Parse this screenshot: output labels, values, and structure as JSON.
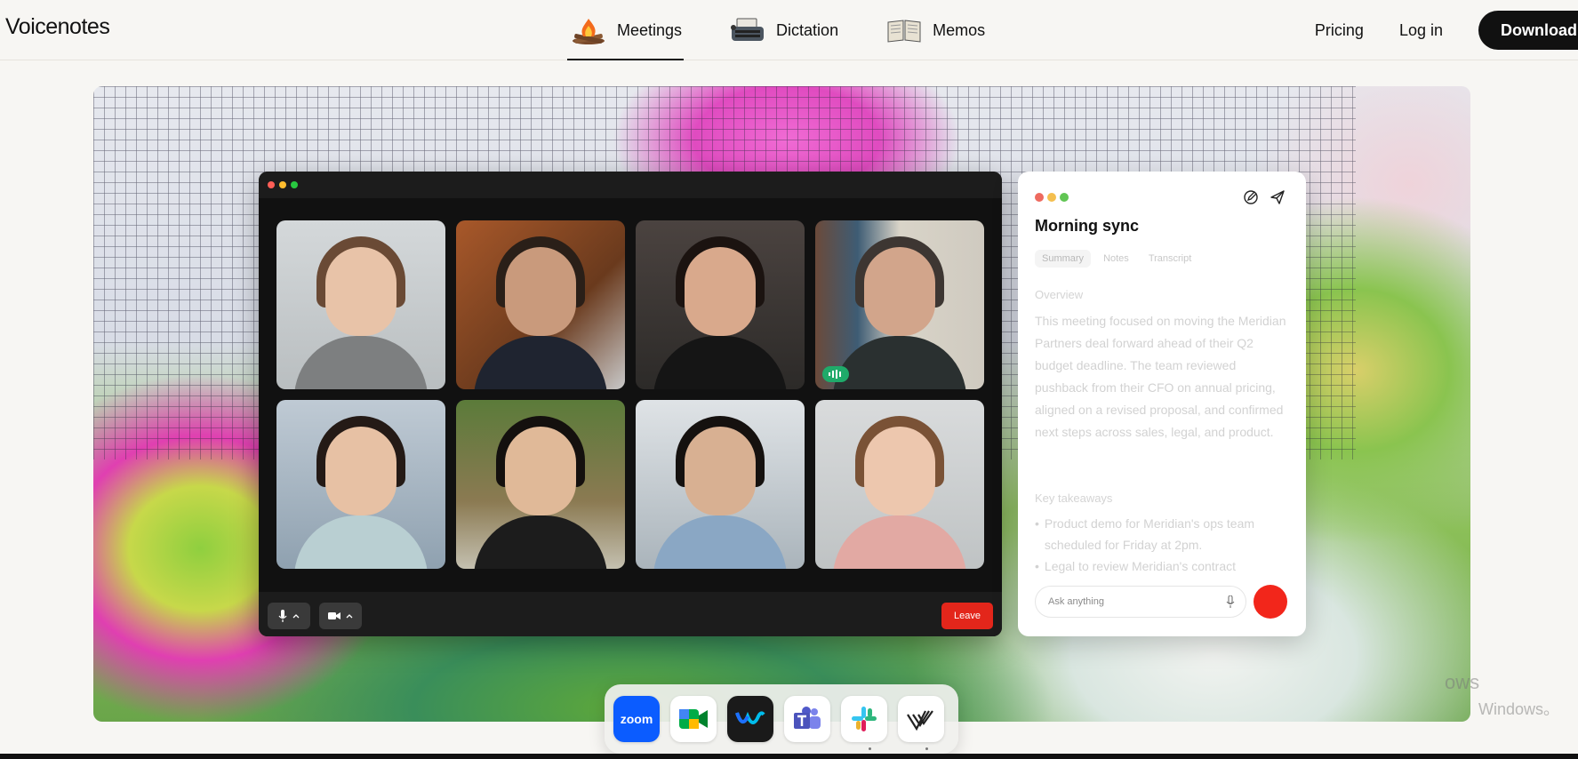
{
  "header": {
    "brand": "Voicenotes",
    "nav": [
      {
        "label": "Meetings",
        "icon": "campfire-icon",
        "active": true
      },
      {
        "label": "Dictation",
        "icon": "typewriter-icon",
        "active": false
      },
      {
        "label": "Memos",
        "icon": "book-icon",
        "active": false
      }
    ],
    "pricing": "Pricing",
    "login": "Log in",
    "download": "Download"
  },
  "call": {
    "leave": "Leave",
    "participants": [
      {
        "id": "participant-1",
        "speaking": false
      },
      {
        "id": "participant-2",
        "speaking": false
      },
      {
        "id": "participant-3",
        "speaking": false
      },
      {
        "id": "participant-4",
        "speaking": true
      },
      {
        "id": "participant-5",
        "speaking": false
      },
      {
        "id": "participant-6",
        "speaking": false
      },
      {
        "id": "participant-7",
        "speaking": false
      },
      {
        "id": "participant-8",
        "speaking": false
      }
    ]
  },
  "notes": {
    "title": "Morning sync",
    "tabs": [
      "Summary",
      "Notes",
      "Transcript"
    ],
    "overview_heading": "Overview",
    "overview_text": "This meeting focused on moving the Meridian Partners deal forward ahead of their Q2 budget deadline. The team reviewed pushback from their CFO on annual pricing, aligned on a revised proposal, and confirmed next steps across sales, legal, and product.",
    "takeaways_heading": "Key takeaways",
    "takeaways": [
      "Product demo for Meridian's ops team scheduled for Friday at 2pm.",
      "Legal to review Meridian's contract"
    ],
    "ask_placeholder": "Ask anything"
  },
  "dock": {
    "apps": [
      {
        "name": "zoom-app",
        "label": "zoom",
        "color": "#0b5cff"
      },
      {
        "name": "google-meet-app",
        "color": "#00ac47"
      },
      {
        "name": "webex-app",
        "color": "#1a1a1a"
      },
      {
        "name": "teams-app",
        "color": "#5059c9"
      },
      {
        "name": "slack-app",
        "color": "#e01e5a"
      },
      {
        "name": "voicenotes-app",
        "color": "#222222"
      }
    ]
  },
  "watermark": {
    "line1": "ows",
    "line2": "Windows。"
  }
}
